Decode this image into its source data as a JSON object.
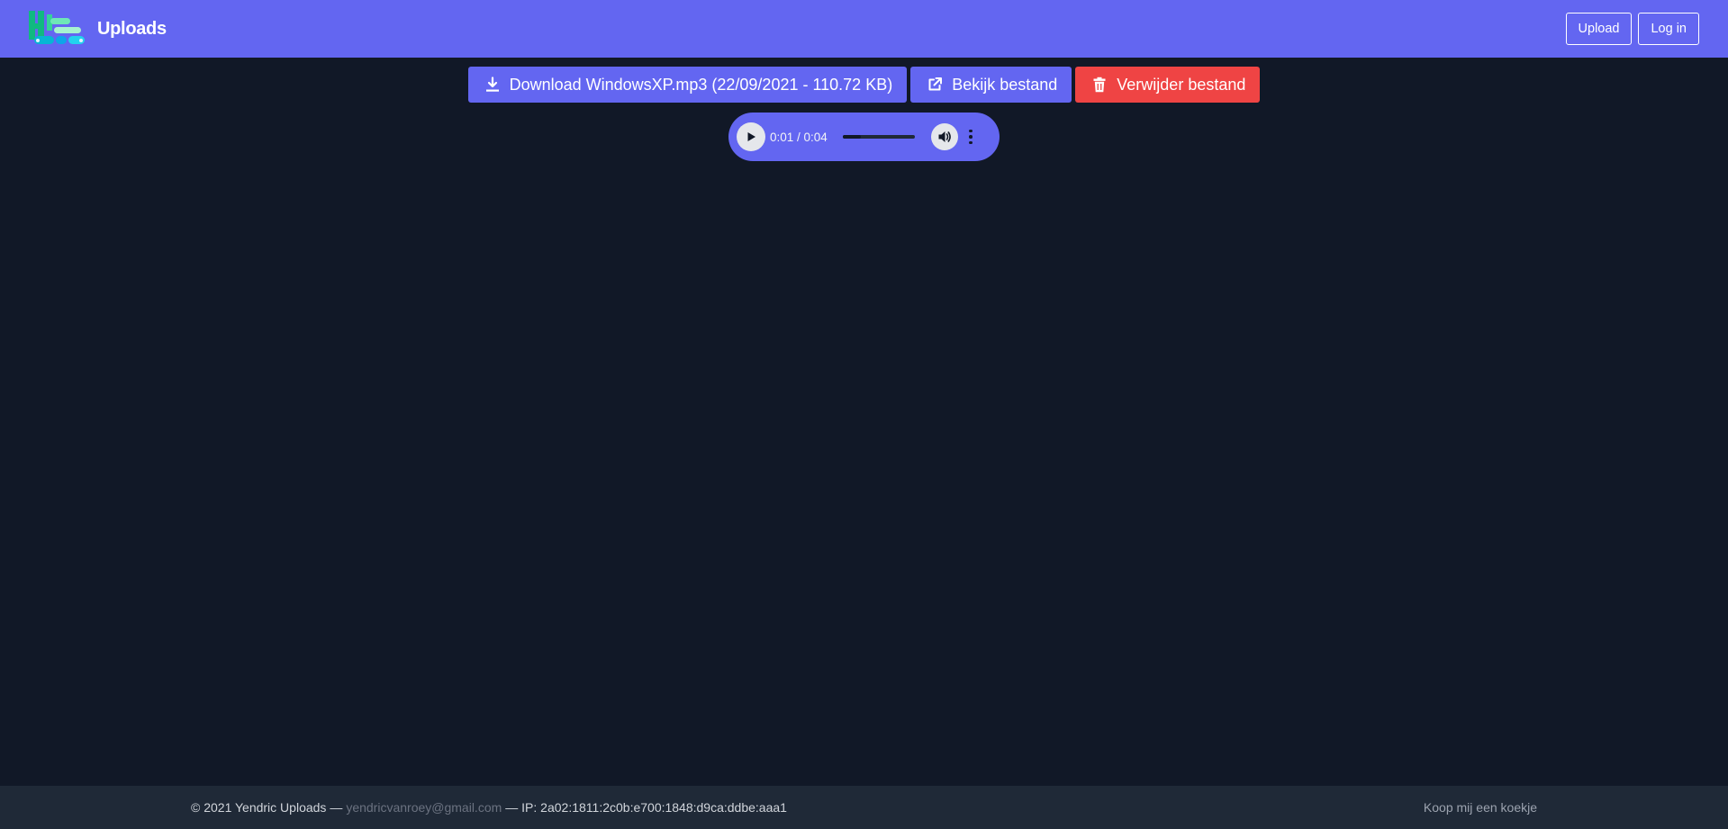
{
  "header": {
    "title": "Uploads",
    "logo_icon": "yendric-uploads-logo",
    "upload_label": "Upload",
    "login_label": "Log in",
    "background_color": "#6366f1"
  },
  "actions": {
    "download_label": "Download WindowsXP.mp3 (22/09/2021 - 110.72 KB)",
    "download_icon": "download-icon",
    "view_label": "Bekijk bestand",
    "view_icon": "external-link-icon",
    "delete_label": "Verwijder bestand",
    "delete_icon": "trash-icon",
    "primary_color": "#6366f1",
    "danger_color": "#ef4444"
  },
  "player": {
    "time": "0:01 / 0:04",
    "progress": 0.25,
    "play_icon": "play-icon",
    "volume_icon": "volume-icon",
    "menu_icon": "more-vertical-icon"
  },
  "footer": {
    "copyright": "© 2021 Yendric Uploads —",
    "email": "yendricvanroey@gmail.com",
    "ip": "— IP: 2a02:1811:2c0b:e700:1848:d9ca:ddbe:aaa1",
    "right_link": "Koop mij een koekje"
  }
}
